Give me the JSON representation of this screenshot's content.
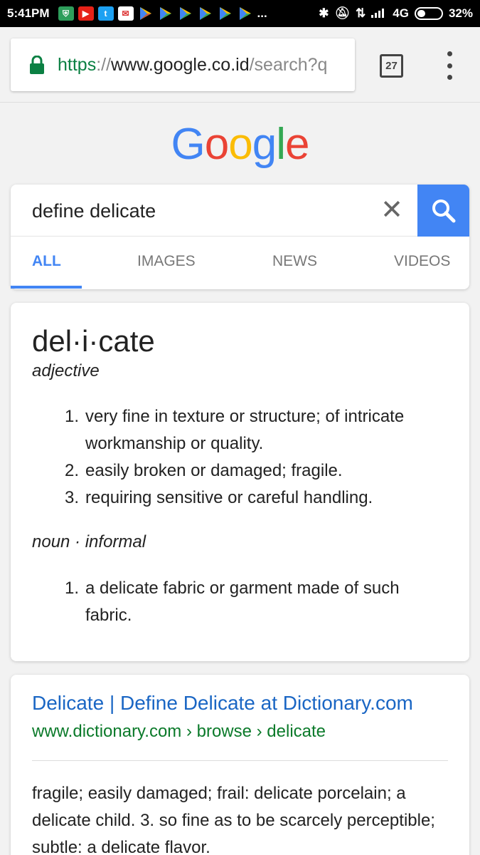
{
  "status_bar": {
    "time": "5:41PM",
    "network": "4G",
    "battery": "32%",
    "battery_level": 0.32,
    "notification_icons": [
      "shield-icon",
      "youtube-icon",
      "twitter-icon",
      "mail-icon",
      "play-store-icon",
      "play-store-icon",
      "play-store-icon",
      "play-store-icon",
      "play-store-icon",
      "play-store-icon"
    ],
    "more": "..."
  },
  "browser": {
    "url_scheme": "https",
    "url_sep": "://",
    "url_host": "www.google.co.id",
    "url_path": "/search?q",
    "tab_count": "27"
  },
  "google": {
    "logo_letters": [
      {
        "char": "G",
        "color": "#4285f4"
      },
      {
        "char": "o",
        "color": "#ea4335"
      },
      {
        "char": "o",
        "color": "#fbbc05"
      },
      {
        "char": "g",
        "color": "#4285f4"
      },
      {
        "char": "l",
        "color": "#34a853"
      },
      {
        "char": "e",
        "color": "#ea4335"
      }
    ],
    "query": "define delicate",
    "tabs": [
      "ALL",
      "IMAGES",
      "NEWS",
      "VIDEOS"
    ],
    "active_tab": "ALL",
    "accent": "#4285f4"
  },
  "definition": {
    "word": "del·i·cate",
    "adjective": {
      "label": "adjective",
      "senses": [
        {
          "num": "1.",
          "text": "very fine in texture or structure; of intricate workmanship or quality."
        },
        {
          "num": "2.",
          "text": "easily broken or damaged; fragile."
        },
        {
          "num": "3.",
          "text": "requiring sensitive or careful handling."
        }
      ]
    },
    "noun": {
      "label": "noun · informal",
      "senses": [
        {
          "num": "1.",
          "text": "a delicate fabric or garment made of such fabric."
        }
      ]
    }
  },
  "result": {
    "title": "Delicate | Define Delicate at Dictionary.com",
    "url": "www.dictionary.com › browse › delicate",
    "snippet": "fragile; easily damaged; frail: delicate porcelain; a delicate child. 3. so fine as to be scarcely perceptible; subtle: a delicate flavor."
  }
}
